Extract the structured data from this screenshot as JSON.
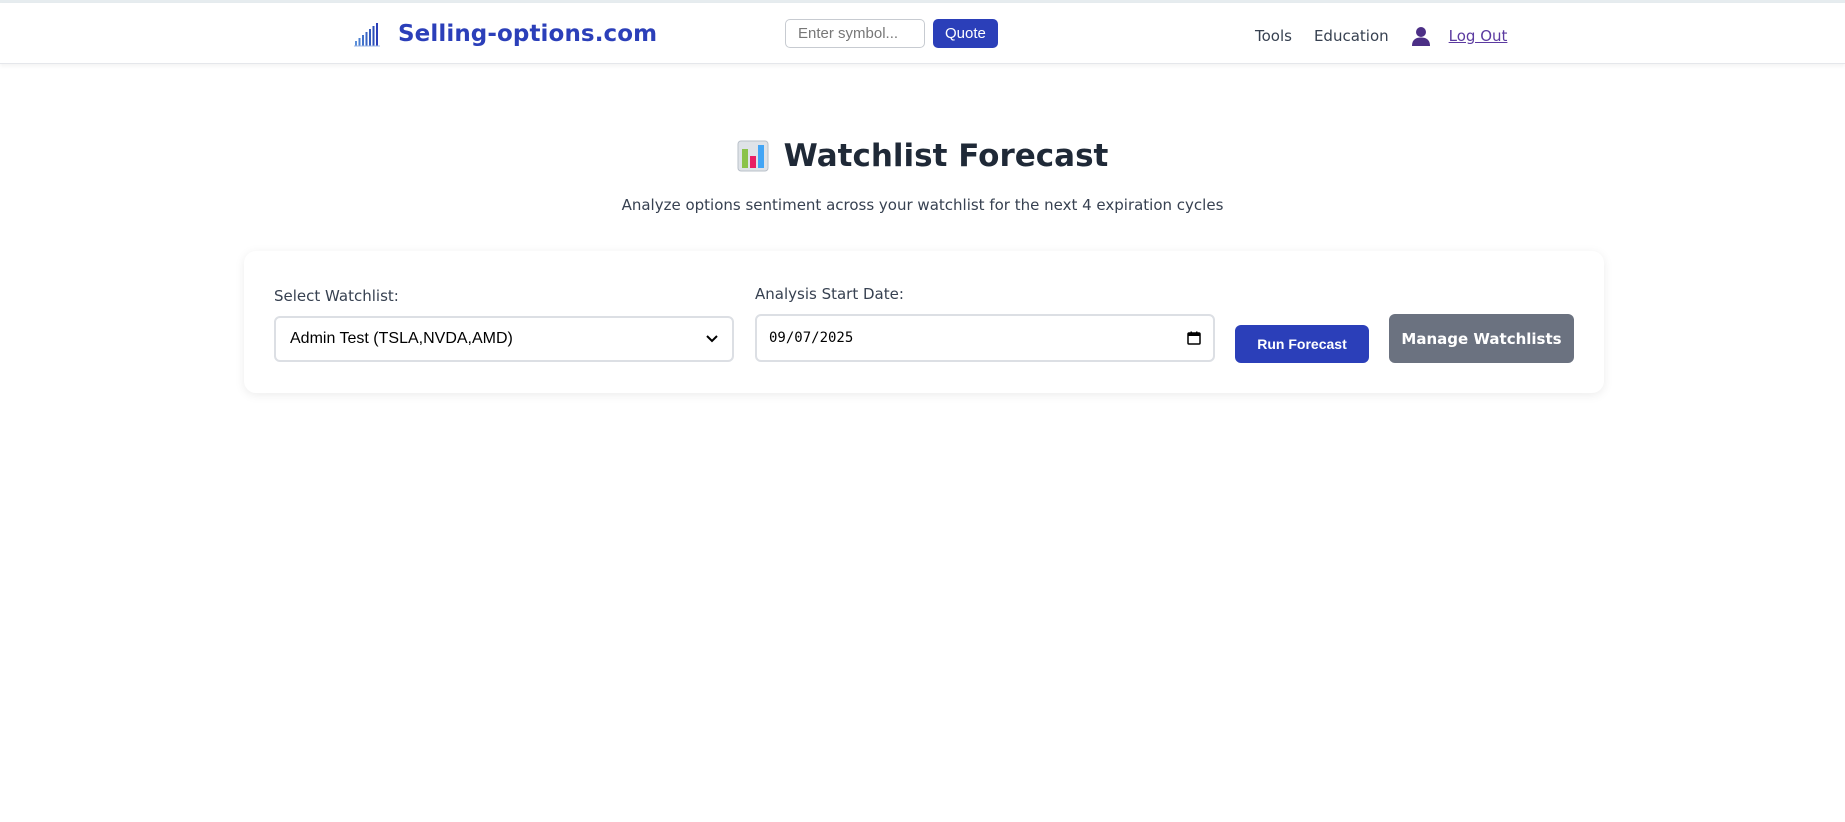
{
  "brand": {
    "name": "Selling-options.com",
    "logo_icon": "signal-bars-icon",
    "color": "#2b3fb9"
  },
  "quote": {
    "placeholder": "Enter symbol...",
    "button_label": "Quote"
  },
  "nav": {
    "items": [
      {
        "label": "Tools"
      },
      {
        "label": "Education"
      }
    ],
    "user_icon": "user-icon",
    "logout_label": "Log Out"
  },
  "page": {
    "title": "Watchlist Forecast",
    "title_icon": "bar-chart-icon",
    "subtitle": "Analyze options sentiment across your watchlist for the next 4 expiration cycles"
  },
  "form": {
    "watchlist_label": "Select Watchlist:",
    "watchlist_selected": "Admin Test (TSLA,NVDA,AMD)",
    "date_label": "Analysis Start Date:",
    "date_value": "09/07/2025",
    "run_button_label": "Run Forecast",
    "manage_button_label": "Manage Watchlists"
  },
  "colors": {
    "primary": "#2b3fb9",
    "secondary_button": "#6b7280",
    "logout_link": "#5b3aa0",
    "heading": "#1f2937"
  }
}
